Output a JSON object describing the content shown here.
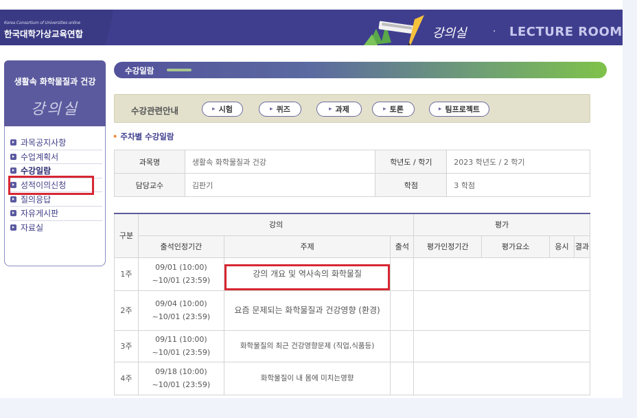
{
  "header": {
    "logo_sub": "Korea Consortium of Universities online",
    "logo_main": "한국대학가상교육연합",
    "banner_ko": "강의실",
    "banner_dot": "·",
    "banner_en": "LECTURE ROOM"
  },
  "sidebar": {
    "course_title": "생활속 화학물질과 건강",
    "classroom_title": "강의실",
    "items": [
      {
        "label": "과목공지사항"
      },
      {
        "label": "수업계획서"
      },
      {
        "label": "수강일람"
      },
      {
        "label": "성적이의신청"
      },
      {
        "label": "질의응답"
      },
      {
        "label": "자유게시판"
      },
      {
        "label": "자료실"
      }
    ]
  },
  "main": {
    "tab_label": "수강일람",
    "guide_label": "수강관련안내",
    "guide_buttons": [
      {
        "label": "시험"
      },
      {
        "label": "퀴즈"
      },
      {
        "label": "과제"
      },
      {
        "label": "토론"
      },
      {
        "label": "팀프로젝트"
      }
    ],
    "arrow_glyph": "▸",
    "section_title": "주차별 수강일람",
    "info": {
      "course_label": "과목명",
      "course_value": "생활속 화학물질과 건강",
      "term_label": "학년도 / 학기",
      "term_value": "2023 학년도 / 2 학기",
      "prof_label": "담당교수",
      "prof_value": "김판기",
      "credit_label": "학점",
      "credit_value": "3 학점"
    },
    "lecture_table": {
      "col_section": "구분",
      "group_lecture": "강의",
      "group_eval": "평가",
      "col_period": "출석인정기간",
      "col_topic": "주제",
      "col_attend": "출석",
      "col_eval_period": "평가인정기간",
      "col_eval_item": "평가요소",
      "col_take": "응시",
      "col_result": "결과",
      "rows": [
        {
          "week": "1주",
          "start": "09/01 (10:00)",
          "end": "~10/01 (23:59)",
          "topic": "강의 개요 및 역사속의 화학물질"
        },
        {
          "week": "2주",
          "start": "09/04 (10:00)",
          "end": "~10/01 (23:59)",
          "topic": "요즘 문제되는 화학물질과 건강영향 (환경)"
        },
        {
          "week": "3주",
          "start": "09/11 (10:00)",
          "end": "~10/01 (23:59)",
          "topic": "화학물질의 최근 건강영향문제 (직업,식품등)"
        },
        {
          "week": "4주",
          "start": "09/18 (10:00)",
          "end": "~10/01 (23:59)",
          "topic": "화학물질이 내 몸에 미치는영향"
        }
      ]
    }
  },
  "colors": {
    "header_bg": "#3f3e8e",
    "highlight": "#d72632",
    "accent_green": "#7fc24a"
  }
}
